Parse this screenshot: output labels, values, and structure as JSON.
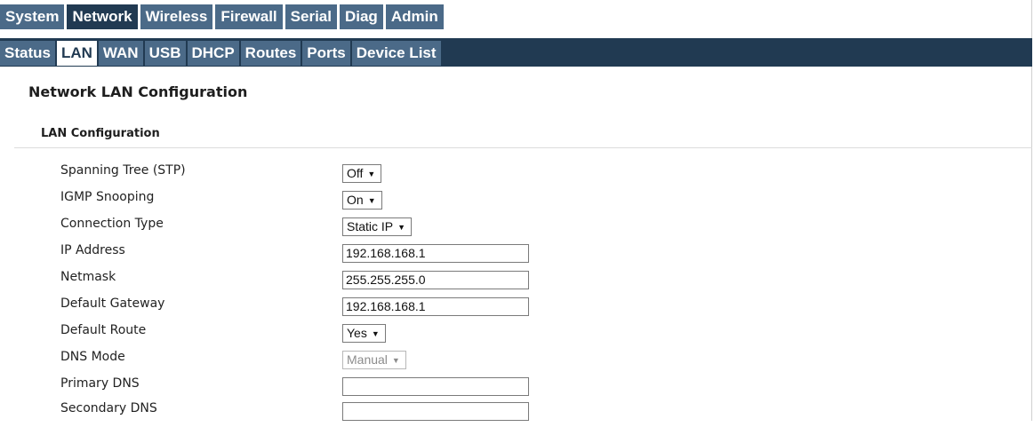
{
  "top_nav": {
    "tabs": [
      {
        "label": "System"
      },
      {
        "label": "Network"
      },
      {
        "label": "Wireless"
      },
      {
        "label": "Firewall"
      },
      {
        "label": "Serial"
      },
      {
        "label": "Diag"
      },
      {
        "label": "Admin"
      }
    ],
    "active": "Network"
  },
  "sub_nav": {
    "tabs": [
      {
        "label": "Status"
      },
      {
        "label": "LAN"
      },
      {
        "label": "WAN"
      },
      {
        "label": "USB"
      },
      {
        "label": "DHCP"
      },
      {
        "label": "Routes"
      },
      {
        "label": "Ports"
      },
      {
        "label": "Device List"
      }
    ],
    "active": "LAN"
  },
  "page": {
    "title": "Network LAN Configuration",
    "section_title": "LAN Configuration"
  },
  "fields": [
    {
      "label": "Spanning Tree (STP)",
      "type": "select",
      "value": "Off"
    },
    {
      "label": "IGMP Snooping",
      "type": "select",
      "value": "On"
    },
    {
      "label": "Connection Type",
      "type": "select",
      "value": "Static IP"
    },
    {
      "label": "IP Address",
      "type": "text",
      "value": "192.168.168.1"
    },
    {
      "label": "Netmask",
      "type": "text",
      "value": "255.255.255.0"
    },
    {
      "label": "Default Gateway",
      "type": "text",
      "value": "192.168.168.1"
    },
    {
      "label": "Default Route",
      "type": "select",
      "value": "Yes"
    },
    {
      "label": "DNS Mode",
      "type": "select",
      "value": "Manual",
      "disabled": true
    },
    {
      "label": "Primary DNS",
      "type": "text",
      "value": ""
    },
    {
      "label": "Secondary DNS",
      "type": "text",
      "value": ""
    }
  ],
  "icons": {
    "dropdown": "chevron-down-icon"
  },
  "colors": {
    "tab_bg": "#4b6a88",
    "tab_active_bg": "#213a52",
    "subnav_bar_bg": "#213a52",
    "subnav_active_bg": "#ffffff"
  }
}
